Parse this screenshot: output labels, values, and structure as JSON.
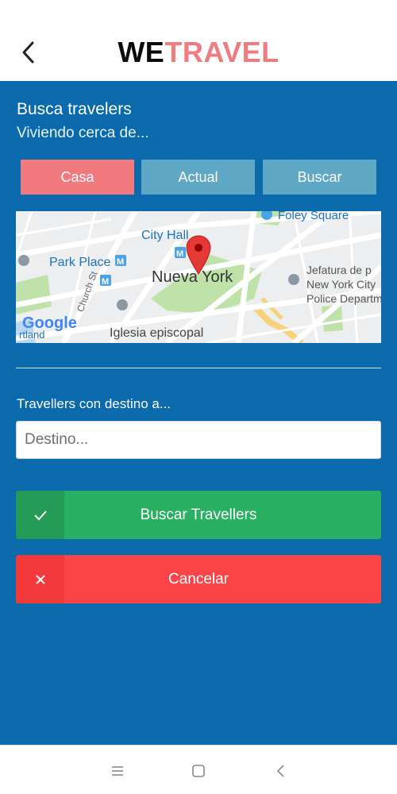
{
  "header": {
    "logo_part1": "WE",
    "logo_part2": "TRAVEL"
  },
  "search": {
    "title": "Busca travelers",
    "subtitle": "Viviendo cerca de...",
    "segments": [
      "Casa",
      "Actual",
      "Buscar"
    ],
    "selected_segment": "Casa"
  },
  "map": {
    "labels": {
      "foley": "Foley Square",
      "cityhall": "City Hall",
      "parkplace": "Park Place",
      "city": "Nueva York",
      "jefatura1": "Jefatura de p",
      "jefatura2": "New York City",
      "jefatura3": "Police Departm",
      "church_st": "Church St",
      "iglesia": "Iglesia episcopal",
      "tland": "rtland",
      "google": "Google"
    }
  },
  "destination": {
    "label": "Travellers con destino a...",
    "placeholder": "Destino...",
    "value": ""
  },
  "actions": {
    "search_label": "Buscar Travellers",
    "cancel_label": "Cancelar"
  },
  "colors": {
    "primary_blue": "#0a6aac",
    "logo_accent": "#f07c80",
    "segment_selected": "#f07a7e",
    "segment_default": "#5ea7c5",
    "success": "#29b063",
    "danger": "#fb4447"
  },
  "icons": {
    "back": "chevron-left-icon",
    "check": "check-icon",
    "close": "close-icon",
    "map_pin": "map-pin-icon",
    "nav_menu": "menu-icon",
    "nav_home": "square-icon",
    "nav_back": "chevron-left-icon"
  }
}
